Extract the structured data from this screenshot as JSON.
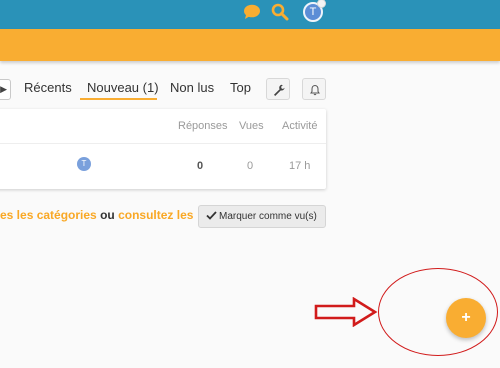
{
  "header": {
    "avatar_letter": "T"
  },
  "tabs": {
    "prev_arrow": "▶",
    "recents": "Récents",
    "nouveau": "Nouveau (1)",
    "non_lus": "Non lus",
    "top": "Top"
  },
  "table": {
    "headers": {
      "reponses": "Réponses",
      "vues": "Vues",
      "activite": "Activité"
    },
    "row": {
      "avatar_letter": "T",
      "reponses": "0",
      "vues": "0",
      "activite": "17 h"
    }
  },
  "footer": {
    "link_categories": "es les catégories",
    "middle": " ou ",
    "link_consultez": "consultez les",
    "mark_button": "Marquer comme vu(s)"
  },
  "fab": {
    "label": "+"
  },
  "colors": {
    "topbar": "#2a92b8",
    "accent": "#f9ad32",
    "annotation": "#d11b1b"
  }
}
